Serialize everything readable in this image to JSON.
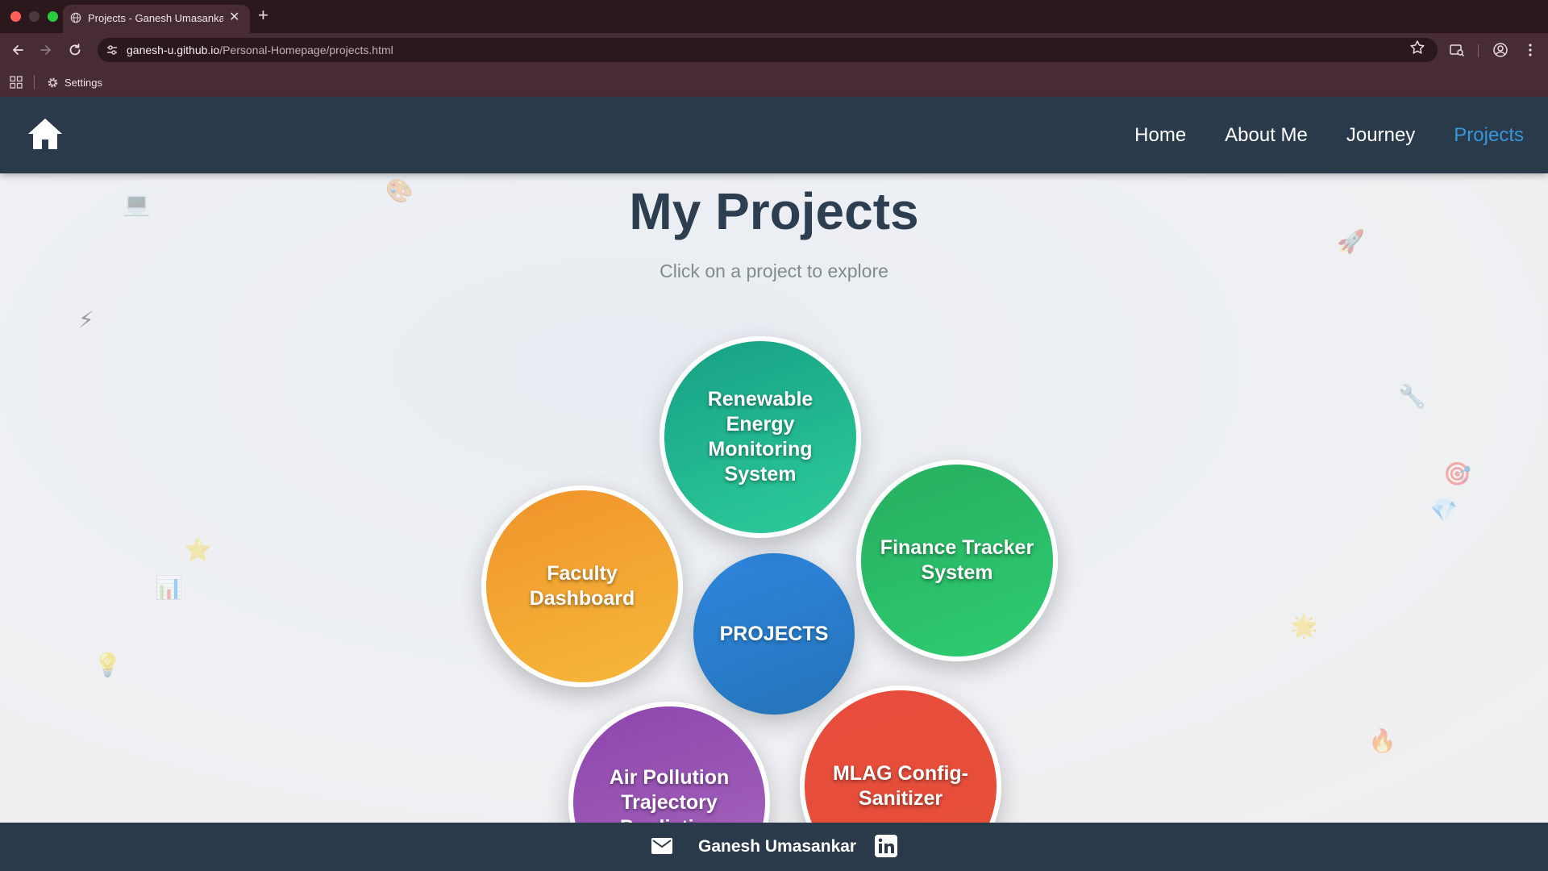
{
  "browser": {
    "tab_title": "Projects - Ganesh Umasankar",
    "url_host": "ganesh-u.github.io",
    "url_path": "/Personal-Homepage/projects.html",
    "bookmark_settings": "Settings"
  },
  "nav": {
    "links": [
      "Home",
      "About Me",
      "Journey",
      "Projects"
    ],
    "active": "Projects",
    "active_color": "#3498db",
    "bg_color": "#2b3a4a"
  },
  "page": {
    "title": "My Projects",
    "subtitle": "Click on a project to explore"
  },
  "projects": {
    "center_label": "PROJECTS",
    "items": [
      {
        "label": "Renewable Energy Monitoring System",
        "color": "#1abc9c"
      },
      {
        "label": "Finance Tracker System",
        "color": "#27ae60"
      },
      {
        "label": "Faculty Dashboard",
        "color": "#f39c12"
      },
      {
        "label": "Air Pollution Trajectory Prediction",
        "color": "#9b59b6"
      },
      {
        "label": "MLAG Config-Sanitizer",
        "color": "#e74c3c"
      }
    ]
  },
  "decorations": [
    "laptop-emoji",
    "palette-emoji",
    "lightning-emoji",
    "star-emoji",
    "bar-chart-emoji",
    "lightbulb-emoji",
    "rocket-emoji",
    "wrench-emoji",
    "target-emoji",
    "gem-emoji",
    "sparkle-star-emoji",
    "fire-emoji"
  ],
  "footer": {
    "name": "Ganesh Umasankar"
  }
}
